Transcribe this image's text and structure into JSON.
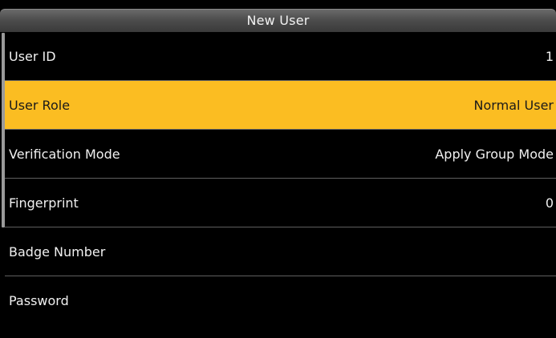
{
  "header": {
    "title": "New User"
  },
  "fields": [
    {
      "label": "User ID",
      "value": "1",
      "selected": false
    },
    {
      "label": "User Role",
      "value": "Normal User",
      "selected": true
    },
    {
      "label": "Verification Mode",
      "value": "Apply Group Mode",
      "selected": false
    },
    {
      "label": "Fingerprint",
      "value": "0",
      "selected": false
    },
    {
      "label": "Badge Number",
      "value": "",
      "selected": false
    },
    {
      "label": "Password",
      "value": "",
      "selected": false
    }
  ],
  "colors": {
    "background": "#000000",
    "selection": "#fbbd22",
    "text": "#f0f0f0",
    "selected_text": "#1a1a1a",
    "divider": "#5f5f5f"
  }
}
